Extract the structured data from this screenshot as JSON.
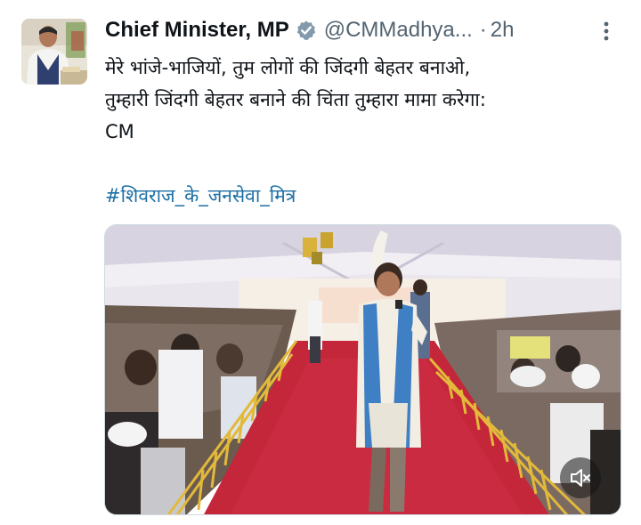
{
  "tweet": {
    "author": {
      "display_name": "Chief Minister, MP",
      "handle": "@CMMadhya...",
      "verified": true,
      "badge_color": "#829aab"
    },
    "separator": "·",
    "time": "2h",
    "text_lines": [
      "मेरे भांजे-भाजियों, तुम लोगों की जिंदगी बेहतर बनाओ,",
      "तुम्हारी जिंदगी बेहतर बनाने की चिंता तुम्हारा मामा करेगा:",
      "CM"
    ],
    "hashtag": "#शिवराज_के_जनसेवा_मित्र",
    "hashtag_color": "#1d6fa5",
    "media": {
      "type": "video",
      "mute_icon": "speaker-muted-icon"
    },
    "more_icon": "more-vertical-icon"
  }
}
